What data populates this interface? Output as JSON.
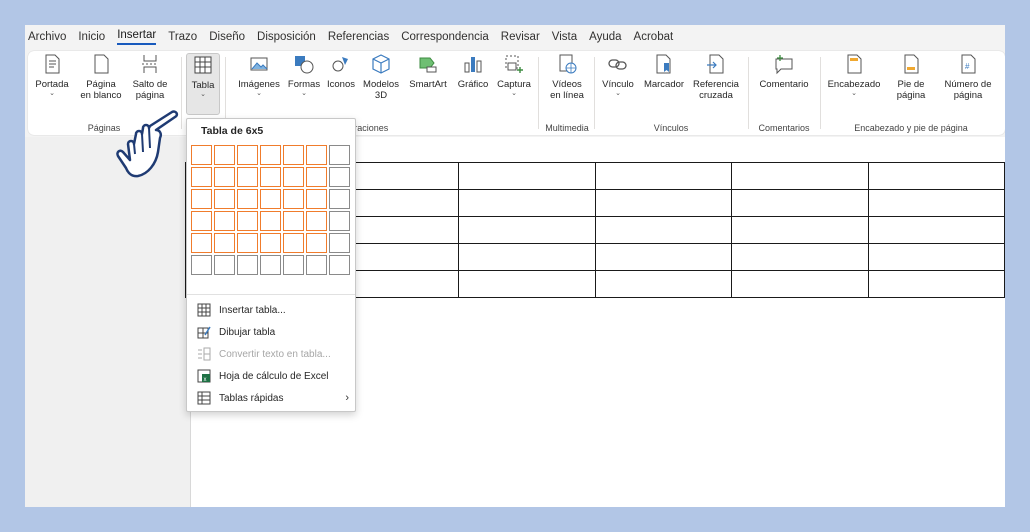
{
  "menu": {
    "tabs": [
      "Archivo",
      "Inicio",
      "Insertar",
      "Trazo",
      "Diseño",
      "Disposición",
      "Referencias",
      "Correspondencia",
      "Revisar",
      "Vista",
      "Ayuda",
      "Acrobat"
    ],
    "active": "Insertar"
  },
  "ribbon": {
    "groups": {
      "paginas": {
        "label": "Páginas",
        "portada": "Portada",
        "pagina_blanco_1": "Página",
        "pagina_blanco_2": "en blanco",
        "salto_1": "Salto de",
        "salto_2": "página"
      },
      "tablas": {
        "tabla": "Tabla"
      },
      "ilustraciones": {
        "label": "Ilustraciones",
        "imagenes": "Imágenes",
        "formas": "Formas",
        "iconos": "Iconos",
        "modelos_1": "Modelos",
        "modelos_2": "3D",
        "smartart": "SmartArt",
        "grafico": "Gráfico",
        "captura": "Captura"
      },
      "multimedia": {
        "label": "Multimedia",
        "videos_1": "Vídeos",
        "videos_2": "en línea"
      },
      "vinculos": {
        "label": "Vínculos",
        "vinculo": "Vínculo",
        "marcador": "Marcador",
        "referencia_1": "Referencia",
        "referencia_2": "cruzada"
      },
      "comentarios": {
        "label": "Comentarios",
        "comentario": "Comentario"
      },
      "encabezado": {
        "label": "Encabezado y pie de página",
        "encabezado": "Encabezado",
        "pie_1": "Pie de",
        "pie_2": "página",
        "numero_1": "Número de",
        "numero_2": "página"
      }
    }
  },
  "dropdown": {
    "title": "Tabla de 6x5",
    "grid": {
      "columns": 7,
      "rows": 6,
      "selected_columns": 6,
      "selected_rows": 5
    },
    "items": [
      {
        "label": "Insertar tabla...",
        "icon": "insert-table-icon",
        "enabled": true
      },
      {
        "label": "Dibujar tabla",
        "icon": "draw-table-icon",
        "enabled": true
      },
      {
        "label": "Convertir texto en tabla...",
        "icon": "convert-text-icon",
        "enabled": false
      },
      {
        "label": "Hoja de cálculo de Excel",
        "icon": "excel-sheet-icon",
        "enabled": true
      },
      {
        "label": "Tablas rápidas",
        "icon": "quick-tables-icon",
        "enabled": true,
        "submenu": true
      }
    ]
  },
  "document": {
    "table_preview": {
      "rows": 5,
      "columns": 6
    }
  },
  "colors": {
    "accent": "#185abd",
    "grid_selected": "#f07c2c",
    "background": "#b2c6e6"
  }
}
